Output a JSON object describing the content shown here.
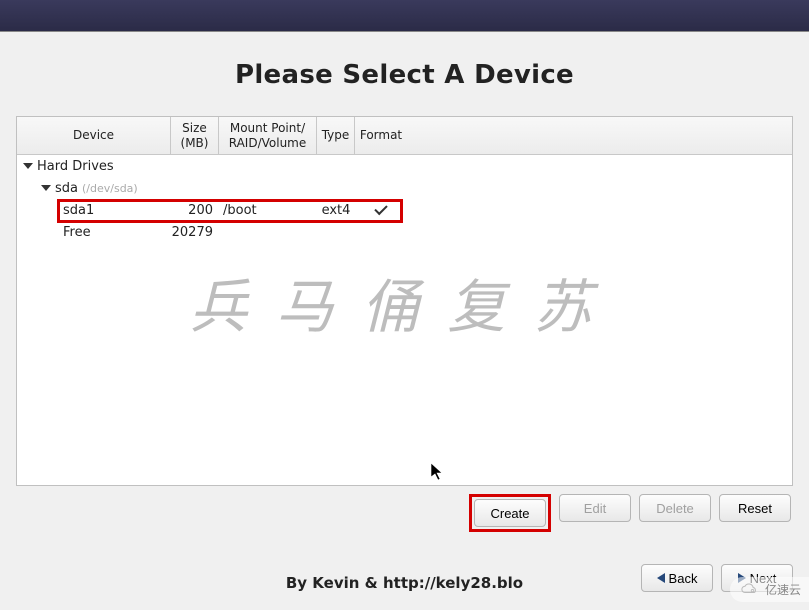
{
  "title": "Please Select A Device",
  "columns": {
    "device": "Device",
    "size": "Size\n(MB)",
    "mount": "Mount Point/\nRAID/Volume",
    "type": "Type",
    "format": "Format"
  },
  "tree": {
    "root": "Hard Drives",
    "disk": {
      "name": "sda",
      "path": "(/dev/sda)"
    },
    "partitions": [
      {
        "name": "sda1",
        "size": "200",
        "mount": "/boot",
        "type": "ext4",
        "format": true
      },
      {
        "name": "Free",
        "size": "20279",
        "mount": "",
        "type": "",
        "format": false
      }
    ]
  },
  "buttons": {
    "create": "Create",
    "edit": "Edit",
    "delete": "Delete",
    "reset": "Reset",
    "back": "Back",
    "next": "Next"
  },
  "watermark": "兵马俑复苏",
  "byline": "By Kevin & http://kely28.blo",
  "badge": "亿速云"
}
